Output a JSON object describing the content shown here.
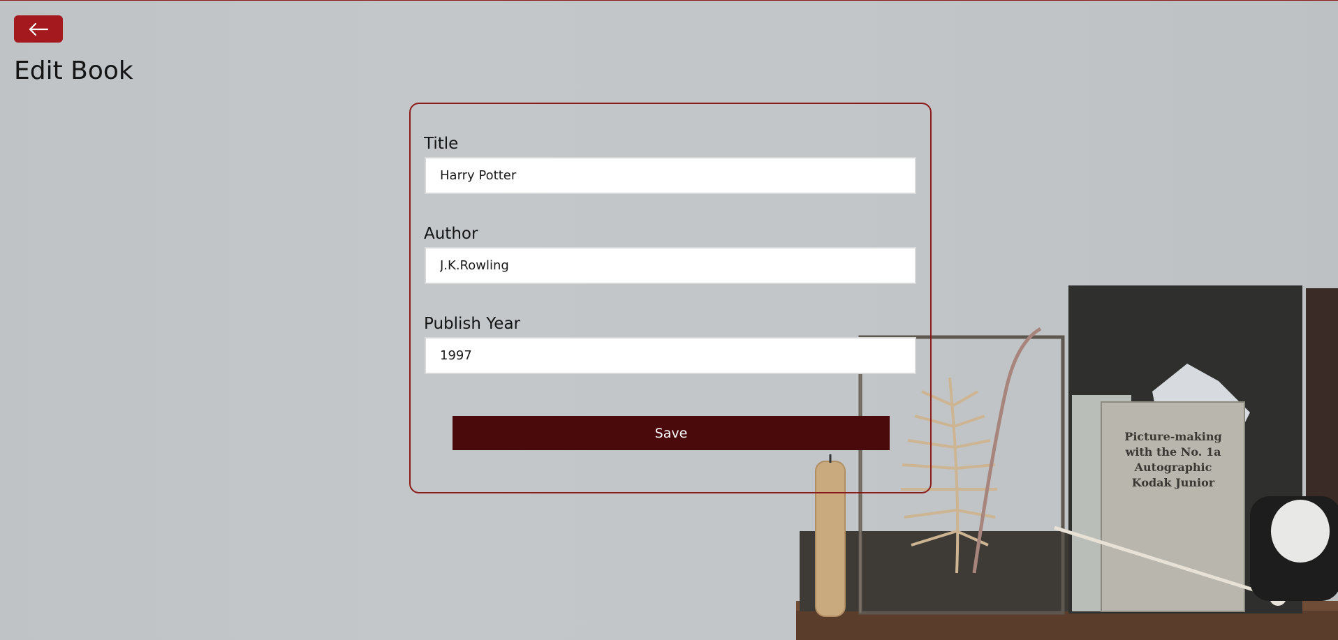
{
  "header": {
    "back_icon": "arrow-left-icon",
    "title": "Edit Book"
  },
  "form": {
    "title_label": "Title",
    "title_value": "Harry Potter",
    "author_label": "Author",
    "author_value": "J.K.Rowling",
    "year_label": "Publish Year",
    "year_value": "1997",
    "save_label": "Save"
  },
  "background_art": {
    "book_cover_text": [
      "Picture-making",
      "with the No. 1a",
      "Autographic",
      "Kodak Junior"
    ]
  },
  "colors": {
    "accent": "#a3191d",
    "card_border": "#8b1a1a",
    "save_button": "#4a0a0b"
  }
}
